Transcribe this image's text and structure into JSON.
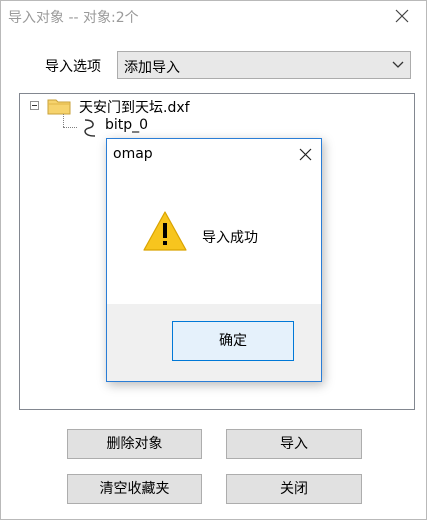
{
  "window": {
    "title": "导入对象 -- 对象:2个"
  },
  "options": {
    "label": "导入选项",
    "selected": "添加导入"
  },
  "tree": {
    "root_label": "天安门到天坛.dxf",
    "child_label": "bitp_0"
  },
  "buttons": {
    "delete": "删除对象",
    "import": "导入",
    "clear": "清空收藏夹",
    "close": "关闭"
  },
  "dialog": {
    "title": "omap",
    "message": "导入成功",
    "ok": "确定"
  },
  "icons": {
    "window_close": "close-icon",
    "dropdown": "chevron-down-icon",
    "folder": "folder-icon",
    "child": "path-icon",
    "warning": "warning-icon",
    "dialog_close": "close-icon"
  },
  "colors": {
    "dialog_border": "#2a7dd6",
    "ok_button_border": "#0078d7",
    "ok_button_fill": "#e5f1fb",
    "warning_fill": "#f7c51e"
  }
}
